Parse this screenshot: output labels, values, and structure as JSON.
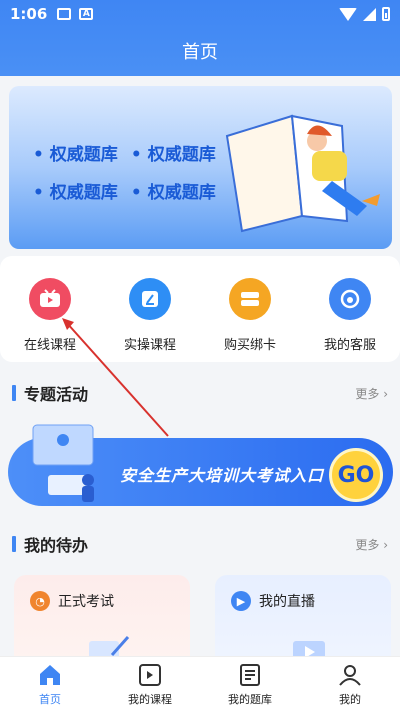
{
  "status_bar": {
    "time": "1:06"
  },
  "header": {
    "title": "首页"
  },
  "banner": {
    "labels": [
      "• 权威题库",
      "• 权威题库",
      "• 权威题库",
      "• 权威题库"
    ]
  },
  "quick_actions": [
    {
      "label": "在线课程",
      "icon": "tv-icon",
      "color": "#f04c62"
    },
    {
      "label": "实操课程",
      "icon": "pen-book-icon",
      "color": "#2e8ef5"
    },
    {
      "label": "购买绑卡",
      "icon": "card-stack-icon",
      "color": "#f5a623"
    },
    {
      "label": "我的客服",
      "icon": "headset-icon",
      "color": "#3f86f3"
    }
  ],
  "special": {
    "title": "专题活动",
    "more": "更多",
    "banner_text": "安全生产大培训大考试入口",
    "go": "GO"
  },
  "todo": {
    "title": "我的待办",
    "more": "更多",
    "cards": [
      {
        "label": "正式考试",
        "icon": "stopwatch-icon"
      },
      {
        "label": "我的直播",
        "icon": "video-icon"
      }
    ]
  },
  "nav": [
    {
      "label": "首页",
      "icon": "home-icon",
      "active": true
    },
    {
      "label": "我的课程",
      "icon": "play-book-icon"
    },
    {
      "label": "我的题库",
      "icon": "question-bank-icon"
    },
    {
      "label": "我的",
      "icon": "user-icon"
    }
  ],
  "accent_color": "#3f86f3"
}
